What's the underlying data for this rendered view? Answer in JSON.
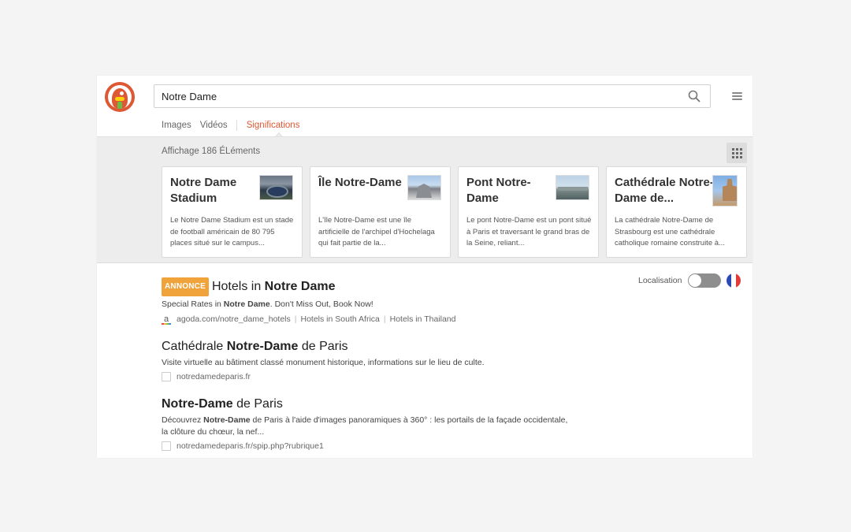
{
  "search": {
    "query": "Notre Dame"
  },
  "tabs": [
    {
      "label": "Images"
    },
    {
      "label": "Vidéos"
    },
    {
      "label": "Significations"
    }
  ],
  "module": {
    "count_text": "Affichage 186 ÉLéments",
    "cards": [
      {
        "title": "Notre Dame Stadium",
        "text": "Le Notre Dame Stadium est un stade de football américain de 80 795 places situé sur le campus..."
      },
      {
        "title": "Île Notre-Dame",
        "text": "L'île Notre-Dame est une île artificielle de l'archipel d'Hochelaga qui fait partie de la..."
      },
      {
        "title": "Pont Notre-Dame",
        "text": "Le pont Notre-Dame est un pont situé à Paris et traversant le grand bras de la Seine, reliant..."
      },
      {
        "title": "Cathédrale Notre-Dame de...",
        "text": "La cathédrale Notre-Dame de Strasbourg est une cathédrale catholique romaine construite à..."
      }
    ]
  },
  "locale": {
    "label": "Localisation",
    "enabled": false
  },
  "results": {
    "ad": {
      "badge": "ANNONCE",
      "title_pre": "Hotels in ",
      "title_bold": "Notre Dame",
      "snippet_pre": "Special Rates in ",
      "snippet_bold": "Notre Dame",
      "snippet_post": ". Don't Miss Out, Book Now!",
      "url": "agoda.com/notre_dame_hotels",
      "link1": "Hotels in South Africa",
      "link2": "Hotels in Thailand"
    },
    "r1": {
      "title_pre": "Cathédrale ",
      "title_bold": "Notre-Dame",
      "title_post": " de Paris",
      "snippet": "Visite virtuelle au bâtiment classé monument historique, informations sur le lieu de culte.",
      "url": "notredamedeparis.fr"
    },
    "r2": {
      "title_bold": "Notre-Dame",
      "title_post": " de Paris",
      "snippet_pre": "Découvrez ",
      "snippet_bold": "Notre-Dame",
      "snippet_post": " de Paris à l'aide d'images panoramiques à 360° : les portails de la façade occidentale, la clôture du chœur, la nef...",
      "url": "notredamedeparis.fr/spip.php?rubrique1"
    }
  },
  "colors": {
    "accent": "#de5833",
    "ad_badge": "#f0a33a"
  }
}
